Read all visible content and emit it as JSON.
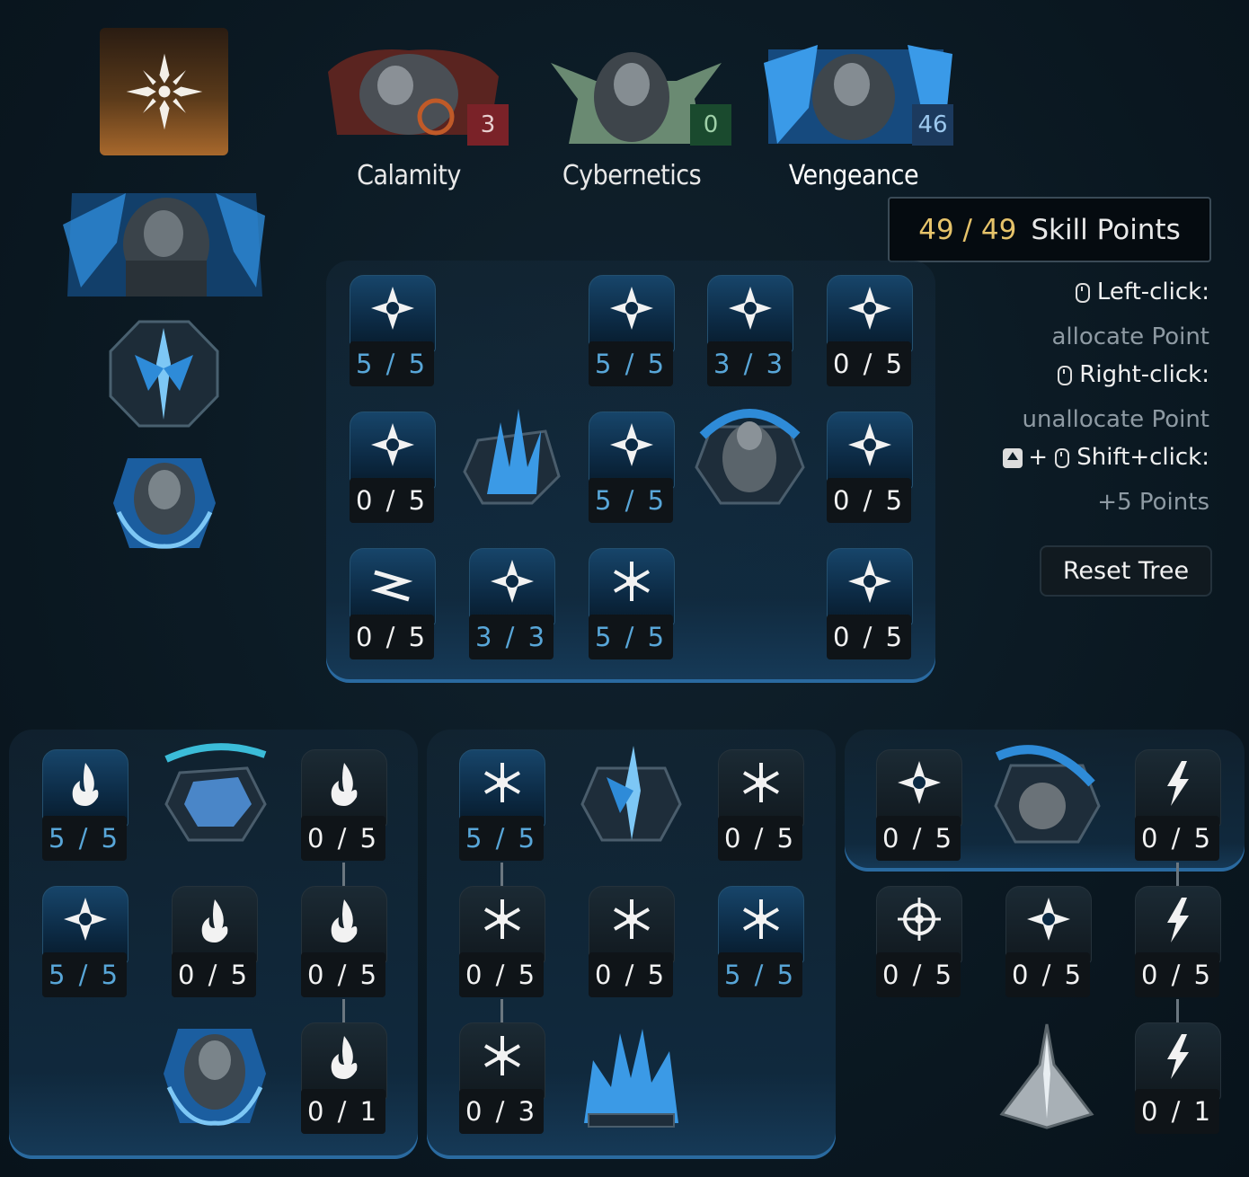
{
  "colors": {
    "background": "#0b1a24",
    "accent_blue": "#58a6d8",
    "skill_points_gold": "#e6c36a",
    "calamity": "#8a2a2e",
    "cybernetics": "#1e5a36",
    "vengeance": "#1c3f66"
  },
  "class_icon": "blade-emblem-icon",
  "trees": [
    {
      "name": "Calamity",
      "points": "3"
    },
    {
      "name": "Cybernetics",
      "points": "0"
    },
    {
      "name": "Vengeance",
      "points": "46"
    }
  ],
  "skill_points": {
    "used": "49",
    "total": "49",
    "separator": "/",
    "label": "Skill Points"
  },
  "help": {
    "left_click": "Left-click:",
    "left_desc": "allocate Point",
    "right_click": "Right-click:",
    "right_desc": "unallocate Point",
    "shift_plus": "+",
    "shift_click": "Shift+click:",
    "shift_desc": "+5 Points"
  },
  "reset_label": "Reset Tree",
  "main_nodes": [
    {
      "count": "5 / 5",
      "icon": "gear-burst-icon"
    },
    {
      "count": "5 / 5",
      "icon": "rifle-upgrade-icon"
    },
    {
      "count": "3 / 3",
      "icon": "sawblade-icon"
    },
    {
      "count": "0 / 5",
      "icon": "turret-icon"
    },
    {
      "count": "0 / 5",
      "icon": "timer-bars-icon"
    },
    {
      "count": "5 / 5",
      "icon": "badge-rifle-icon"
    },
    {
      "count": "0 / 5",
      "icon": "cross-grenade-icon"
    },
    {
      "count": "0 / 5",
      "icon": "dash-zigzag-icon"
    },
    {
      "count": "3 / 3",
      "icon": "crossed-badge-icon"
    },
    {
      "count": "5 / 5",
      "icon": "snowflake-burst-icon"
    },
    {
      "count": "0 / 5",
      "icon": "cart-bomb-icon"
    }
  ],
  "left_nodes": [
    {
      "count": "5 / 5",
      "icon": "flame-dash-icon"
    },
    {
      "count": "0 / 5",
      "icon": "crossed-flame-icon"
    },
    {
      "count": "5 / 5",
      "icon": "shield-rifle-icon"
    },
    {
      "count": "0 / 5",
      "icon": "skull-flame-icon"
    },
    {
      "count": "0 / 5",
      "icon": "campfire-icon"
    },
    {
      "count": "0 / 1",
      "icon": "flame-star-icon"
    }
  ],
  "middle_nodes": [
    {
      "count": "5 / 5",
      "icon": "frost-cross-icon"
    },
    {
      "count": "0 / 5",
      "icon": "skull-frost-icon"
    },
    {
      "count": "0 / 5",
      "icon": "frost-gear-icon"
    },
    {
      "count": "0 / 5",
      "icon": "frost-shield-icon"
    },
    {
      "count": "5 / 5",
      "icon": "frost-flake-icon"
    },
    {
      "count": "0 / 3",
      "icon": "frost-dash-icon"
    }
  ],
  "right_nodes": [
    {
      "count": "0 / 5",
      "icon": "grenade-arrow-icon"
    },
    {
      "count": "0 / 5",
      "icon": "lightning-cross-icon"
    },
    {
      "count": "0 / 5",
      "icon": "target-reticle-icon"
    },
    {
      "count": "0 / 5",
      "icon": "spark-burst-icon"
    },
    {
      "count": "0 / 5",
      "icon": "lightning-bolt-icon"
    },
    {
      "count": "0 / 1",
      "icon": "lightning-strike-icon"
    }
  ]
}
